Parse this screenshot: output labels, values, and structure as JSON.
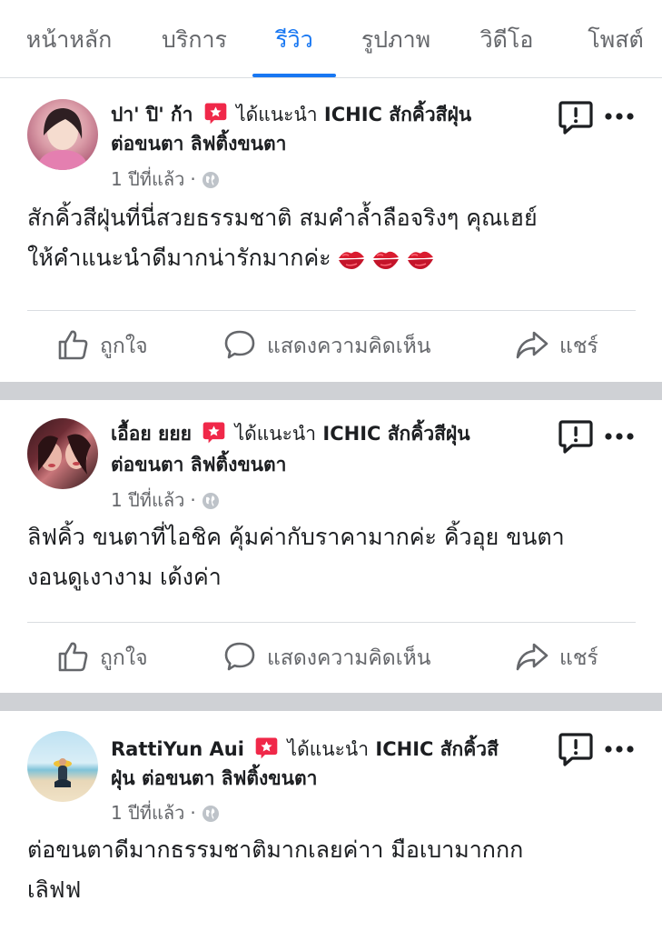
{
  "tabs": [
    {
      "label": "หน้าหลัก",
      "active": false
    },
    {
      "label": "บริการ",
      "active": false
    },
    {
      "label": "รีวิว",
      "active": true
    },
    {
      "label": "รูปภาพ",
      "active": false
    },
    {
      "label": "วิดีโอ",
      "active": false
    },
    {
      "label": "โพสต์",
      "active": false
    }
  ],
  "colors": {
    "accent": "#1877f2",
    "recommend_badge": "#f02849",
    "secondary_text": "#65676b",
    "separator": "#cfd1d5"
  },
  "action_labels": {
    "like": "ถูกใจ",
    "comment": "แสดงความคิดเห็น",
    "share": "แชร์"
  },
  "posts": [
    {
      "author": "ปา' ปิ' ก้า",
      "recommends": "ได้แนะนำ",
      "page_line1": "ICHIC สักคิ้วสีฝุ่น",
      "page_line2": "ต่อขนตา ลิฟติ้งขนตา",
      "time": "1 ปีที่แล้ว",
      "text": "สักคิ้วสีฝุ่นที่นี่สวยธรรมชาติ สมคำล้ำลือจริงๆ คุณเฮย์",
      "text2": "ให้คำแนะนำดีมากน่ารักมากค่ะ",
      "emoji": "kiss-mark-icon x3"
    },
    {
      "author": "เอื้อย ยยย",
      "recommends": "ได้แนะนำ",
      "page_line1": "ICHIC สักคิ้วสีฝุ่น",
      "page_line2": "ต่อขนตา ลิฟติ้งขนตา",
      "time": "1 ปีที่แล้ว",
      "text": "ลิฟคิ้ว ขนตาที่ไอชิค คุ้มค่ากับราคามากค่ะ คิ้วอุย ขนตา",
      "text2": "งอนดูเงางาม เด้งค่า"
    },
    {
      "author": "RattiYun Aui",
      "recommends": "ได้แนะนำ",
      "page_line1": "ICHIC สักคิ้วสี",
      "page_line2": "ฝุ่น ต่อขนตา ลิฟติ้งขนตา",
      "time": "1 ปีที่แล้ว",
      "text": "ต่อขนตาดีมากธรรมชาติมากเลยค่าา มือเบามากกก",
      "text2": "เลิฟฟ"
    }
  ]
}
